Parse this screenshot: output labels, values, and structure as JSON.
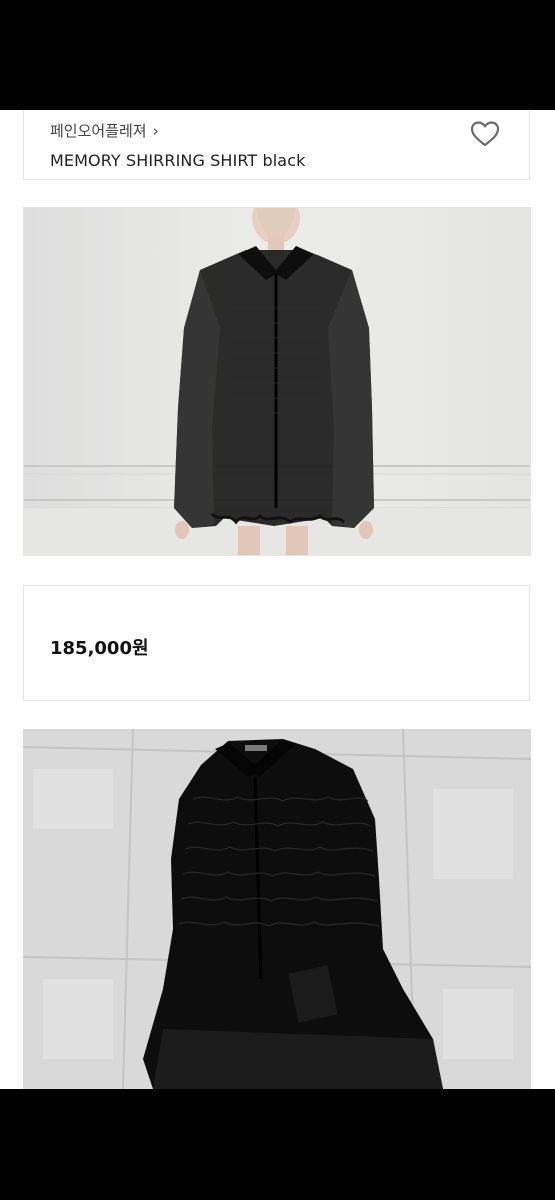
{
  "header": {
    "brand": "페인오어플레져",
    "brand_chevron": "›",
    "title": "MEMORY SHIRRING SHIRT black",
    "wishlist_icon": "heart-outline-icon"
  },
  "price": {
    "amount": "185,000원"
  },
  "images": [
    {
      "name": "model-photo",
      "subject": "model-wearing-sheer-black-shirt"
    },
    {
      "name": "flatlay-photo",
      "subject": "black-shirring-shirt-on-floor-tiles"
    }
  ],
  "colors": {
    "bar": "#000000",
    "border": "#e6e6e6",
    "text": "#222222",
    "wall": "#e6e6e4",
    "garment": "#0d0d0d"
  }
}
